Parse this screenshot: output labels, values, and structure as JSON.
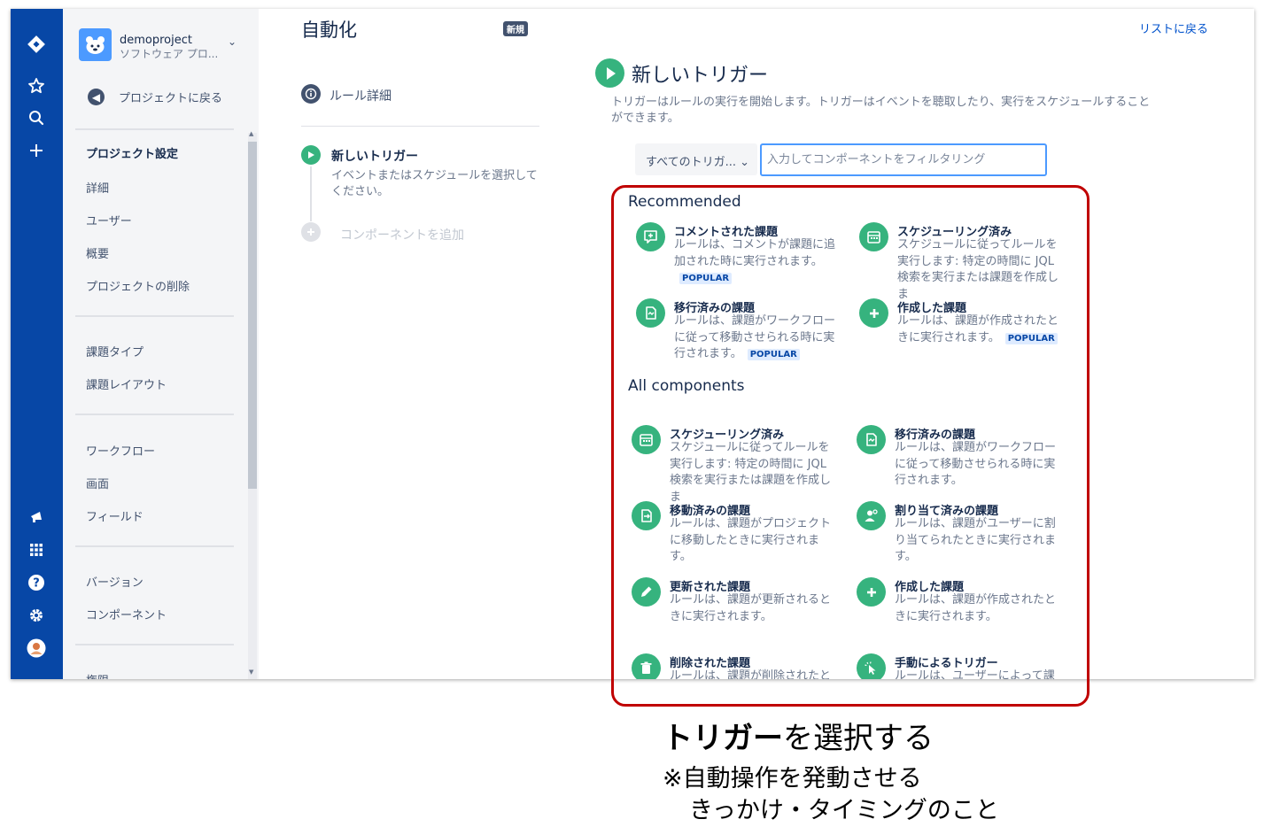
{
  "global_nav": {
    "icons": [
      "jira-logo-icon",
      "star-icon",
      "search-icon",
      "plus-icon",
      "megaphone-icon",
      "app-switcher-icon",
      "help-icon",
      "settings-icon",
      "avatar-icon"
    ]
  },
  "sidebar": {
    "project_name": "demoproject",
    "project_type": "ソフトウェア プロ...",
    "back_label": "プロジェクトに戻る",
    "section_title": "プロジェクト設定",
    "group1": [
      "詳細",
      "ユーザー",
      "概要",
      "プロジェクトの削除"
    ],
    "group2": [
      "課題タイプ",
      "課題レイアウト"
    ],
    "group3": [
      "ワークフロー",
      "画面",
      "フィールド"
    ],
    "group4": [
      "バージョン",
      "コンポーネント"
    ],
    "group5": [
      "権限"
    ]
  },
  "header": {
    "title": "自動化",
    "badge": "新規",
    "back_to_list": "リストに戻る"
  },
  "steps": {
    "rule_detail": "ルール詳細",
    "new_trigger": "新しいトリガー",
    "new_trigger_desc": "イベントまたはスケジュールを選択してください。",
    "add_component": "コンポーネントを追加"
  },
  "panel": {
    "title": "新しいトリガー",
    "description": "トリガーはルールの実行を開始します。トリガーはイベントを聴取したり、実行をスケジュールすることができます。",
    "filter_select": "すべてのトリガ... ⌄",
    "filter_placeholder": "入力してコンポーネントをフィルタリング",
    "recommended_heading": "Recommended",
    "all_heading": "All components",
    "popular_label": "POPULAR",
    "recommended": [
      {
        "icon": "comment-icon",
        "title": "コメントされた課題",
        "desc": "ルールは、コメントが課題に追加された時に実行されます。",
        "popular": true
      },
      {
        "icon": "calendar-icon",
        "title": "スケジューリング済み",
        "desc": "スケジュールに従ってルールを実行します: 特定の時間に JQL 検索を実行または課題を作成しま",
        "popular": false
      },
      {
        "icon": "transition-icon",
        "title": "移行済みの課題",
        "desc": "ルールは、課題がワークフローに従って移動させられる時に実行されます。",
        "popular": true
      },
      {
        "icon": "plus-circle-icon",
        "title": "作成した課題",
        "desc": "ルールは、課題が作成されたときに実行されます。",
        "popular": true
      }
    ],
    "all": [
      {
        "icon": "calendar-icon",
        "title": "スケジューリング済み",
        "desc": "スケジュールに従ってルールを実行します: 特定の時間に JQL 検索を実行または課題を作成しま"
      },
      {
        "icon": "transition-icon",
        "title": "移行済みの課題",
        "desc": "ルールは、課題がワークフローに従って移動させられる時に実行されます。"
      },
      {
        "icon": "move-icon",
        "title": "移動済みの課題",
        "desc": "ルールは、課題がプロジェクトに移動したときに実行されます。"
      },
      {
        "icon": "assign-icon",
        "title": "割り当て済みの課題",
        "desc": "ルールは、課題がユーザーに割り当てられたときに実行されます。"
      },
      {
        "icon": "pencil-icon",
        "title": "更新された課題",
        "desc": "ルールは、課題が更新されるときに実行されます。"
      },
      {
        "icon": "plus-circle-icon",
        "title": "作成した課題",
        "desc": "ルールは、課題が作成されたときに実行されます。"
      },
      {
        "icon": "trash-icon",
        "title": "削除された課題",
        "desc": "ルールは、課題が削除されたと"
      },
      {
        "icon": "pointer-icon",
        "title": "手動によるトリガー",
        "desc": "ルールは、ユーザーによって課"
      }
    ]
  },
  "caption": {
    "title_bold": "トリガー",
    "title_rest": "を選択する",
    "line1": "※自動操作を発動させる",
    "line2": "きっかけ・タイミングのこと"
  },
  "colors": {
    "nav": "#0747a6",
    "accent_green": "#36b37e",
    "annotation_red": "#c00000",
    "link_blue": "#0052cc"
  }
}
